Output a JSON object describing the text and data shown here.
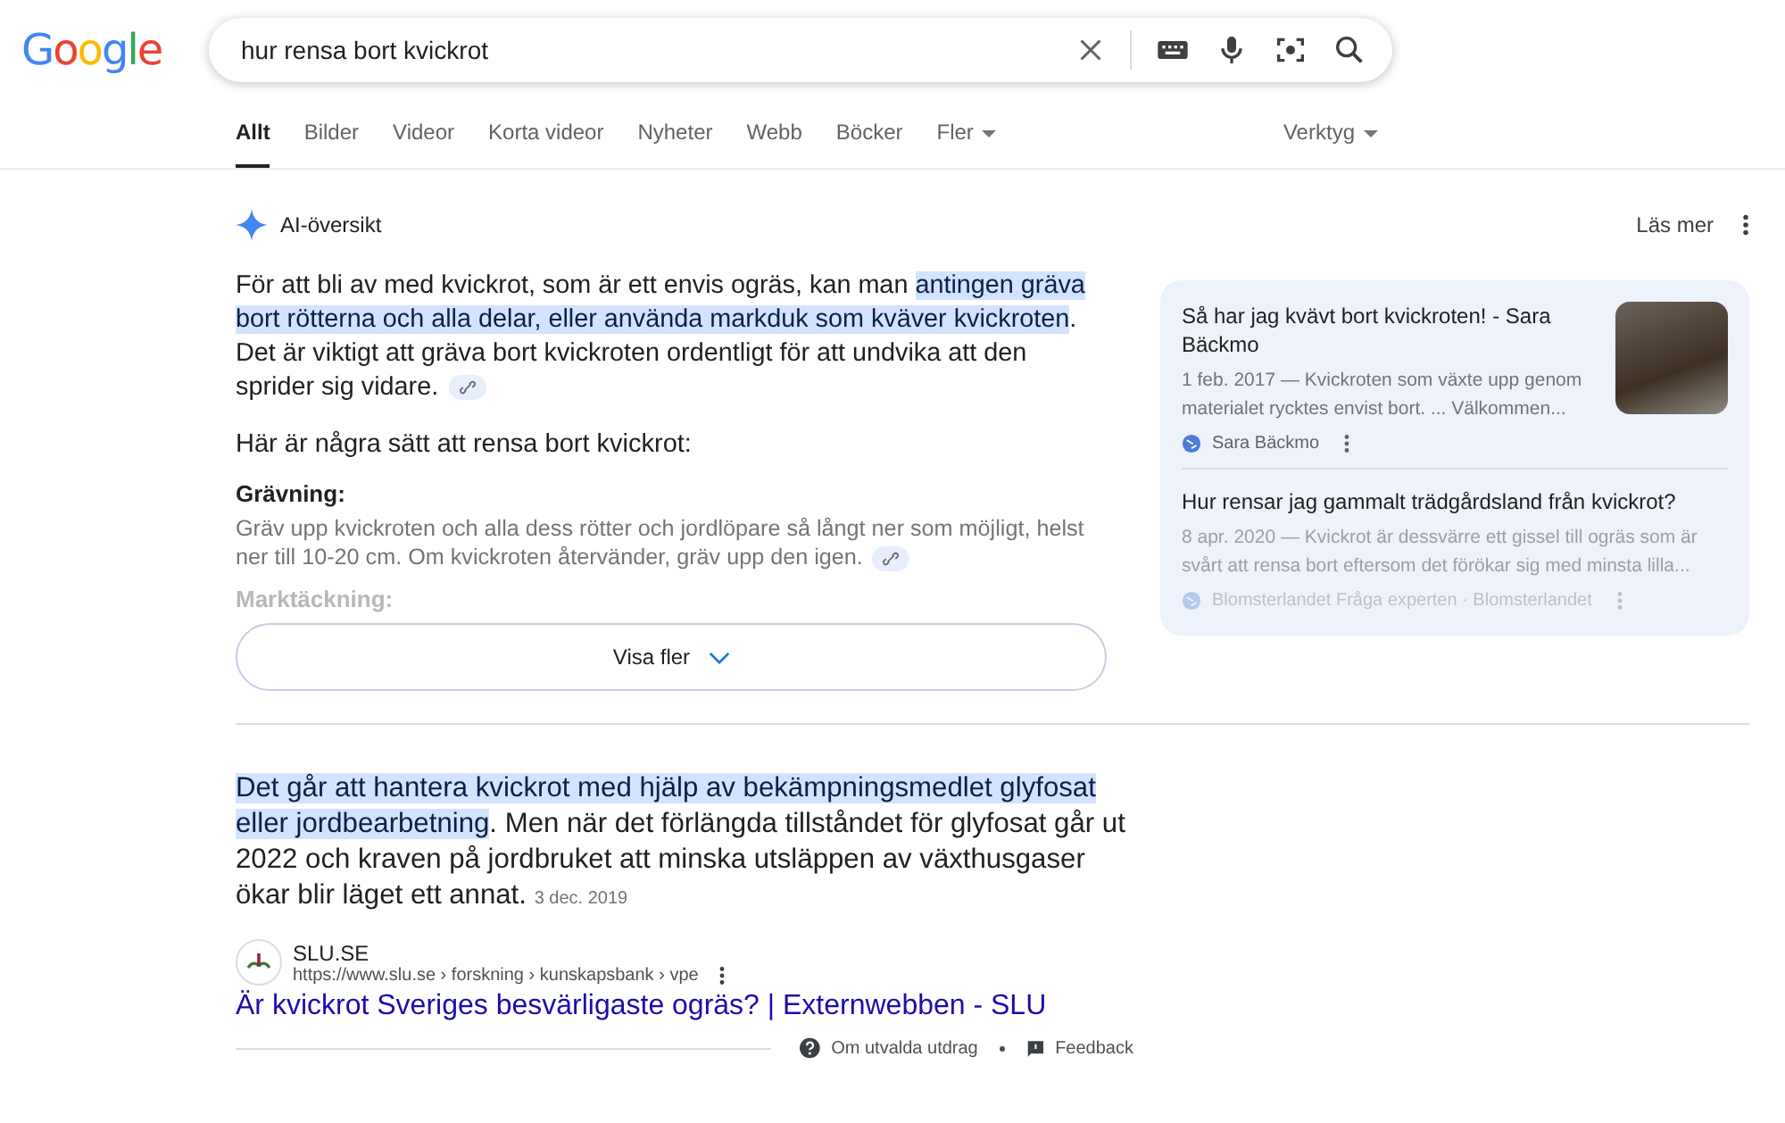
{
  "logo": "Google",
  "search": {
    "value": "hur rensa bort kvickrot"
  },
  "tabs": [
    {
      "label": "Allt",
      "selected": true
    },
    {
      "label": "Bilder",
      "selected": false
    },
    {
      "label": "Videor",
      "selected": false
    },
    {
      "label": "Korta videor",
      "selected": false
    },
    {
      "label": "Nyheter",
      "selected": false
    },
    {
      "label": "Webb",
      "selected": false
    },
    {
      "label": "Böcker",
      "selected": false
    },
    {
      "label": "Fler",
      "selected": false,
      "dropdown": true
    }
  ],
  "tools": "Verktyg",
  "ai_overview": {
    "title": "AI-översikt",
    "read_more": "Läs mer",
    "intro": [
      {
        "text": "För att bli av med kvickrot, som är ett envis ogräs, kan man ",
        "highlighted": false
      },
      {
        "text": "antingen gräva bort rötterna och alla delar, eller använda markduk som kväver kvickroten",
        "highlighted": true
      },
      {
        "text": ". Det är viktigt att gräva bort kvickroten ordentligt för att undvika att den sprider sig vidare.",
        "highlighted": false
      }
    ],
    "heading": "Här är några sätt att rensa bort kvickrot:",
    "sections": [
      {
        "title": "Grävning:",
        "body": "Gräv upp kvickroten och alla dess rötter och jordlöpare så långt ner som möjligt, helst ner till 10-20 cm. Om kvickroten återvänder, gräv upp den igen.",
        "faded": false
      },
      {
        "title": "Marktäckning:",
        "faded": true
      }
    ],
    "show_more": "Visa fler",
    "sources": [
      {
        "title": "Så har jag kvävt bort kvickroten! - Sara Bäckmo",
        "snippet": "1 feb. 2017 — Kvickroten som växte upp genom materialet rycktes envist bort. ... Välkommen...",
        "site": "Sara Bäckmo",
        "thumbnail": true,
        "faded": false
      },
      {
        "title": "Hur rensar jag gammalt trädgårdsland från kvickrot?",
        "snippet": "8 apr. 2020 — Kvickrot är dessvärre ett gissel till ogräs som är svårt att rensa bort eftersom det förökar sig med minsta lilla...",
        "site": "Blomsterlandet Fråga experten · Blomsterlandet",
        "thumbnail": false,
        "faded": true
      }
    ]
  },
  "featured_snippet": {
    "text": [
      {
        "text": "Det går att hantera kvickrot med hjälp av bekämpningsmedlet glyfosat eller jordbearbetning",
        "highlighted": true
      },
      {
        "text": ". Men när det förlängda tillståndet för glyfosat går ut 2022 och kraven på jordbruket att minska utsläppen av växthusgaser ökar blir läget ett annat.",
        "highlighted": false
      }
    ],
    "date": "3 dec. 2019",
    "site": "SLU.SE",
    "url": "https://www.slu.se › forskning › kunskapsbank › vpe",
    "link": "Är kvickrot Sveriges besvärligaste ogräs? | Externwebben - SLU",
    "about": "Om utvalda utdrag",
    "feedback": "Feedback"
  }
}
